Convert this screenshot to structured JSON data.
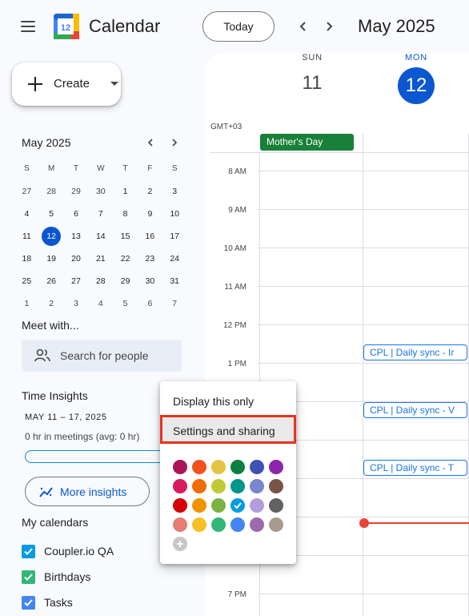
{
  "header": {
    "logo_text": "12",
    "app_title": "Calendar",
    "today_label": "Today",
    "month_title": "May 2025"
  },
  "create": {
    "label": "Create"
  },
  "mini_calendar": {
    "title": "May 2025",
    "weekday_headers": [
      "S",
      "M",
      "T",
      "W",
      "T",
      "F",
      "S"
    ],
    "weeks": [
      [
        "27",
        "28",
        "29",
        "30",
        "1",
        "2",
        "3"
      ],
      [
        "4",
        "5",
        "6",
        "7",
        "8",
        "9",
        "10"
      ],
      [
        "11",
        "12",
        "13",
        "14",
        "15",
        "16",
        "17"
      ],
      [
        "18",
        "19",
        "20",
        "21",
        "22",
        "23",
        "24"
      ],
      [
        "25",
        "26",
        "27",
        "28",
        "29",
        "30",
        "31"
      ],
      [
        "1",
        "2",
        "3",
        "4",
        "5",
        "6",
        "7"
      ]
    ],
    "today": "12"
  },
  "meet": {
    "title": "Meet with...",
    "search_placeholder": "Search for people"
  },
  "time_insights": {
    "title": "Time Insights",
    "range": "MAY 11 – 17, 2025",
    "hours_text": "0 hr in meetings (avg: 0 hr)",
    "more_label": "More insights"
  },
  "my_calendars": {
    "title": "My calendars",
    "items": [
      {
        "label": "Coupler.io QA",
        "color": "#039be5"
      },
      {
        "label": "Birthdays",
        "color": "#33b679"
      },
      {
        "label": "Tasks",
        "color": "#4285f4"
      }
    ]
  },
  "main": {
    "days": [
      {
        "dow": "SUN",
        "num": "11"
      },
      {
        "dow": "MON",
        "num": "12"
      }
    ],
    "timezone": "GMT+03",
    "allday_event": "Mother's Day",
    "hours": [
      "8 AM",
      "9 AM",
      "10 AM",
      "11 AM",
      "12 PM",
      "1 PM",
      "7 PM"
    ],
    "events": [
      "CPL | Daily sync - Ir",
      "CPL | Daily sync - V",
      "CPL | Daily sync - T"
    ]
  },
  "popup": {
    "item_display_only": "Display this only",
    "item_settings": "Settings and sharing",
    "colors": [
      [
        "#ad1457",
        "#f4511e",
        "#e4c441",
        "#0b8043",
        "#3f51b5",
        "#8e24aa"
      ],
      [
        "#d81b60",
        "#ef6c00",
        "#c0ca33",
        "#009688",
        "#7986cb",
        "#795548"
      ],
      [
        "#d50000",
        "#f09300",
        "#7cb342",
        "#039be5",
        "#b39ddb",
        "#616161"
      ],
      [
        "#e67c73",
        "#f6bf26",
        "#33b679",
        "#4285f4",
        "#9e69af",
        "#a79b8e"
      ]
    ],
    "selected_color": "#039be5"
  },
  "colors": {
    "accent": "#0b57d0",
    "event_green": "#188038",
    "now_line": "#ea4335",
    "highlight_border": "#e8321f"
  }
}
